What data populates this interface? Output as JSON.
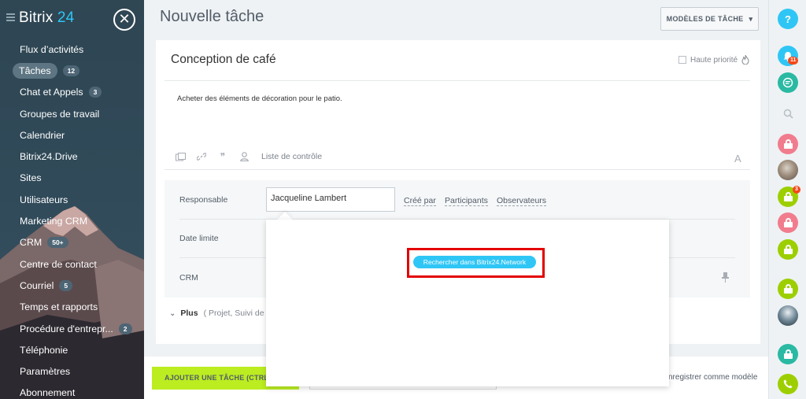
{
  "app": {
    "logo_text": "Bitrix",
    "logo_number": "24"
  },
  "sidebar": {
    "items": [
      {
        "label": "Flux d’activités",
        "badge": ""
      },
      {
        "label": "Tâches",
        "badge": "12",
        "active": true
      },
      {
        "label": "Chat et Appels",
        "badge": "3"
      },
      {
        "label": "Groupes de travail",
        "badge": ""
      },
      {
        "label": "Calendrier",
        "badge": ""
      },
      {
        "label": "Bitrix24.Drive",
        "badge": ""
      },
      {
        "label": "Sites",
        "badge": ""
      },
      {
        "label": "Utilisateurs",
        "badge": ""
      },
      {
        "label": "Marketing CRM",
        "badge": ""
      },
      {
        "label": "CRM",
        "badge": "50+"
      },
      {
        "label": "Centre de contact",
        "badge": ""
      },
      {
        "label": "Courriel",
        "badge": "5"
      },
      {
        "label": "Temps et rapports",
        "badge": ""
      },
      {
        "label": "Procédure d'entrepr...",
        "badge": "2"
      },
      {
        "label": "Téléphonie",
        "badge": ""
      },
      {
        "label": "Paramètres",
        "badge": ""
      },
      {
        "label": "Abonnement",
        "badge": ""
      }
    ]
  },
  "page": {
    "title": "Nouvelle tâche",
    "templates_button": "MODÈLES DE TÂCHE"
  },
  "task": {
    "title": "Conception de café",
    "high_priority_label": "Haute priorité",
    "description": "Acheter des éléments de décoration pour le patio.",
    "checklist_label": "Liste de contrôle",
    "font_button": "A"
  },
  "fields": {
    "responsible_label": "Responsable",
    "responsible_value": "Jacqueline Lambert",
    "created_by": "Créé par",
    "participants": "Participants",
    "observers": "Observateurs",
    "deadline_label": "Date limite",
    "crm_label": "CRM"
  },
  "more": {
    "label": "Plus",
    "hint": "( Projet,  Suivi de"
  },
  "popup": {
    "search_network_button": "Rechercher dans Bitrix24.Network"
  },
  "bottom": {
    "add_task_button": "AJOUTER UNE TÂCHE (CTRL+ENTRÉE)",
    "save_template": "nregistrer comme modèle"
  },
  "rightbar": {
    "help": "?",
    "notifications_count": "11",
    "lock_badge_count": "3"
  },
  "colors": {
    "accent_blue": "#2fc6f6",
    "add_button_green": "#bbed21",
    "highlight_red": "#e30000",
    "badge_red": "#f54819"
  }
}
